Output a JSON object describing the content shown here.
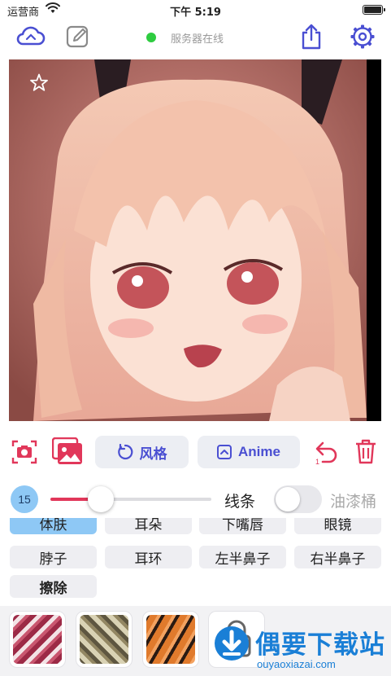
{
  "status_bar": {
    "carrier": "运营商",
    "time": "下午 5:19"
  },
  "toolbar": {
    "server_status": "服务器在线",
    "server_color": "#2ecc40",
    "icons": [
      "cloud-sync-icon",
      "edit-icon",
      "share-icon",
      "gear-icon"
    ]
  },
  "image": {
    "subject": "anime-style portrait",
    "favorite_icon": "star-outline-icon"
  },
  "actions": {
    "style_label": "风格",
    "anime_label": "Anime",
    "undo_badge": "1",
    "icons": [
      "camera-icon",
      "photo-library-icon",
      "rotate-icon",
      "image-frame-icon",
      "undo-icon",
      "trash-icon"
    ]
  },
  "brush": {
    "size": "15",
    "size_fraction": 0.28,
    "line_label": "线条",
    "bucket_label": "油漆桶",
    "bucket_enabled": false,
    "accent": "#e1375a"
  },
  "regions": {
    "row1": [
      "体肤",
      "耳朵",
      "下嘴唇",
      "眼镜"
    ],
    "row2": [
      "脖子",
      "耳环",
      "左半鼻子",
      "右半鼻子"
    ],
    "erase_label": "擦除",
    "active": "体肤",
    "active_color": "#8ec8f5"
  },
  "textures": [
    "texture-red-swirl",
    "texture-olive-leaf",
    "texture-orange-tiger",
    "texture-locked"
  ],
  "watermark": {
    "title": "偶要下载站",
    "url": "ouyaoxiazai.com"
  }
}
